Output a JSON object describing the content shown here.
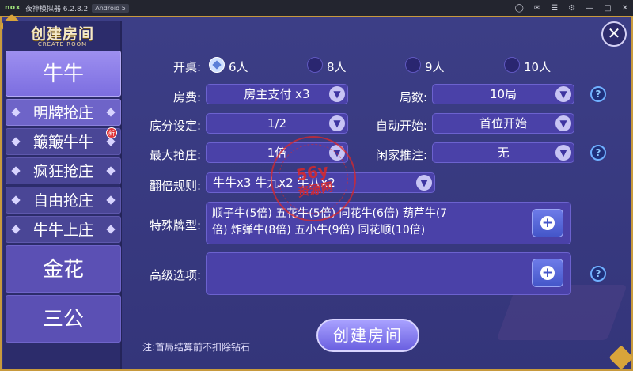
{
  "emulator": {
    "logo": "nox",
    "title": "夜神模拟器 6.2.8.2",
    "android": "Android 5",
    "controls": [
      "shirt-icon",
      "mail-icon",
      "menu-icon",
      "settings-icon",
      "minimize-icon",
      "restore-icon",
      "close-window-icon"
    ]
  },
  "header": {
    "title": "创建房间",
    "subtitle": "CREATE ROOM"
  },
  "sidebar": {
    "game_niuniu": "牛牛",
    "modes": [
      "明牌抢庄",
      "簸簸牛牛",
      "疯狂抢庄",
      "自由抢庄",
      "牛牛上庄"
    ],
    "new_badge": "新",
    "game_jinhua": "金花",
    "game_sangong": "三公"
  },
  "form": {
    "table_label": "开桌:",
    "table_options": [
      "6人",
      "8人",
      "9人",
      "10人"
    ],
    "table_selected": "6人",
    "fee_label": "房费:",
    "fee_value": "房主支付 x3",
    "rounds_label": "局数:",
    "rounds_value": "10局",
    "base_label": "底分设定:",
    "base_value": "1/2",
    "autostart_label": "自动开始:",
    "autostart_value": "首位开始",
    "maxbid_label": "最大抢庄:",
    "maxbid_value": "1倍",
    "idle_label": "闲家推注:",
    "idle_value": "无",
    "double_label": "翻倍规则:",
    "double_value": "牛牛x3  牛九x2  牛八x2",
    "special_label": "特殊牌型:",
    "special_line1": "顺子牛(5倍)  五花牛(5倍)  同花牛(6倍)  葫芦牛(7",
    "special_line2": "倍)  炸弹牛(8倍)  五小牛(9倍)  同花顺(10倍)",
    "advanced_label": "高级选项:",
    "help": "?",
    "plus": "+",
    "note": "注:首局结算前不扣除钻石",
    "create_button": "创建房间",
    "close": "✕"
  },
  "watermark": {
    "line1": "56y",
    "line2": "资源网"
  },
  "colors": {
    "frame_border": "#c89a3d",
    "panel_bg": "#3c3e86",
    "field_bg": "#4a41a8",
    "accent": "#7c6ee0"
  }
}
